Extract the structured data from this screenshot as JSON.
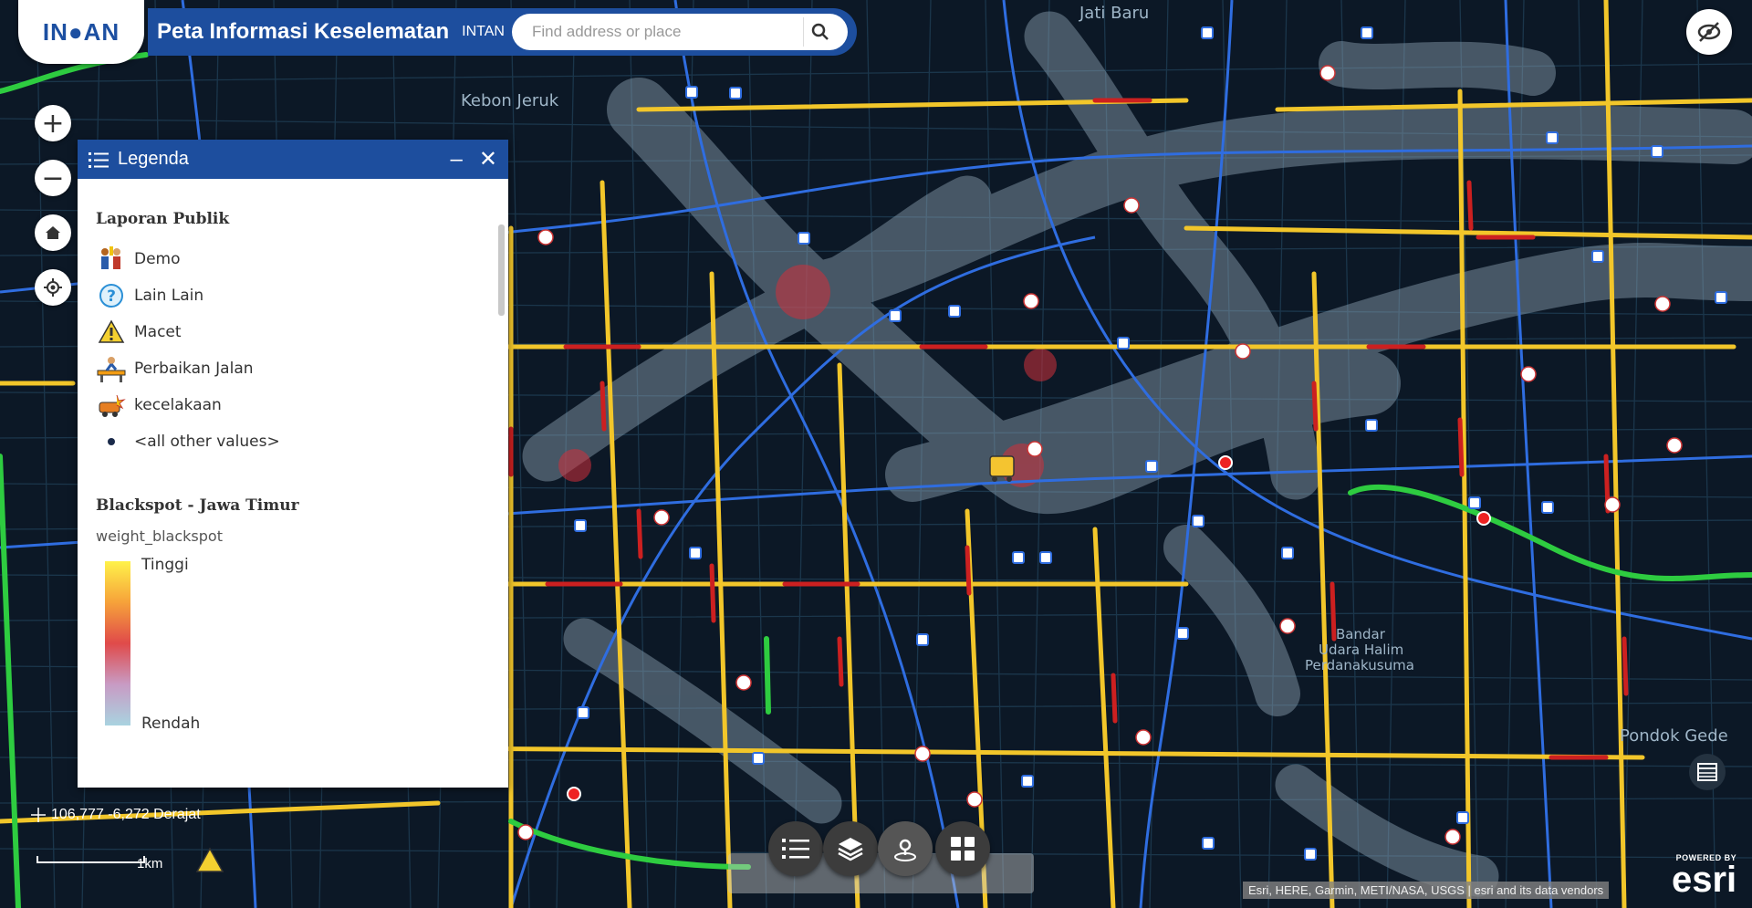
{
  "app": {
    "logo_text": "IN●AN",
    "title": "Peta Informasi Keselematan",
    "subtitle": "INTAN"
  },
  "search": {
    "placeholder": "Find address or place"
  },
  "zoom": {
    "in": "+",
    "out": "−"
  },
  "legend": {
    "title": "Legenda",
    "minimize": "–",
    "close": "✕",
    "section1_title": "Laporan Publik",
    "items": [
      {
        "label": "Demo",
        "icon": "crowd-icon"
      },
      {
        "label": "Lain Lain",
        "icon": "question-icon"
      },
      {
        "label": "Macet",
        "icon": "warning-icon"
      },
      {
        "label": "Perbaikan Jalan",
        "icon": "roadwork-icon"
      },
      {
        "label": "kecelakaan",
        "icon": "accident-icon"
      },
      {
        "label": "<all other values>",
        "icon": "dot-icon"
      }
    ],
    "section2_title": "Blackspot - Jawa Timur",
    "field": "weight_blackspot",
    "ramp_high": "Tinggi",
    "ramp_low": "Rendah"
  },
  "map_labels": {
    "a": "Jati Baru",
    "b": "Kebon Jeruk",
    "c1": "Bandar",
    "c2": "Udara Halim",
    "c3": "Perdanakusuma",
    "d": "Pondok Gede"
  },
  "coords": "106,777 -6,272 Derajat",
  "scale": "1km",
  "attribution": "Esri, HERE, Garmin, METI/NASA, USGS | esri and its data vendors",
  "esri": {
    "powered": "POWERED BY",
    "brand": "esri"
  },
  "colors": {
    "header": "#1d4e9e",
    "road_major": "#f2c62a",
    "road_hot": "#cc2020",
    "road_blue": "#2f6de0",
    "road_green": "#2ecc40",
    "heatmap": "#8fa5b5"
  }
}
